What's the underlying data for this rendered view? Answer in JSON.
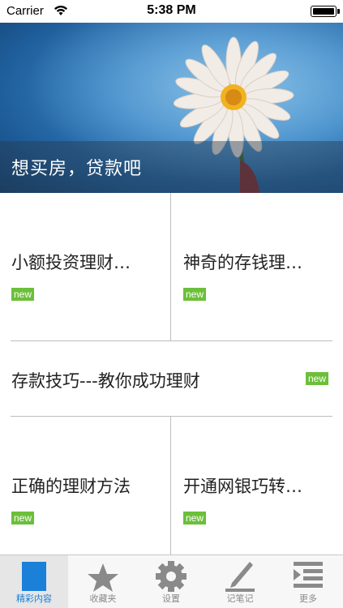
{
  "status_bar": {
    "carrier": "Carrier",
    "time": "5:38 PM"
  },
  "banner": {
    "title": "想买房，贷款吧"
  },
  "items": [
    {
      "title": "小额投资理财…",
      "badge": "new"
    },
    {
      "title": "神奇的存钱理…",
      "badge": "new"
    },
    {
      "title": "存款技巧---教你成功理财",
      "badge": "new"
    },
    {
      "title": "正确的理财方法",
      "badge": "new"
    },
    {
      "title": "开通网银巧转…",
      "badge": "new"
    }
  ],
  "tabs": [
    {
      "label": "精彩内容",
      "icon": "featured-icon",
      "active": true
    },
    {
      "label": "收藏夹",
      "icon": "star-icon"
    },
    {
      "label": "设置",
      "icon": "gear-icon"
    },
    {
      "label": "记笔记",
      "icon": "pen-icon"
    },
    {
      "label": "更多",
      "icon": "list-icon"
    }
  ],
  "colors": {
    "accent": "#1a80d8",
    "badge": "#6cbf3a"
  }
}
